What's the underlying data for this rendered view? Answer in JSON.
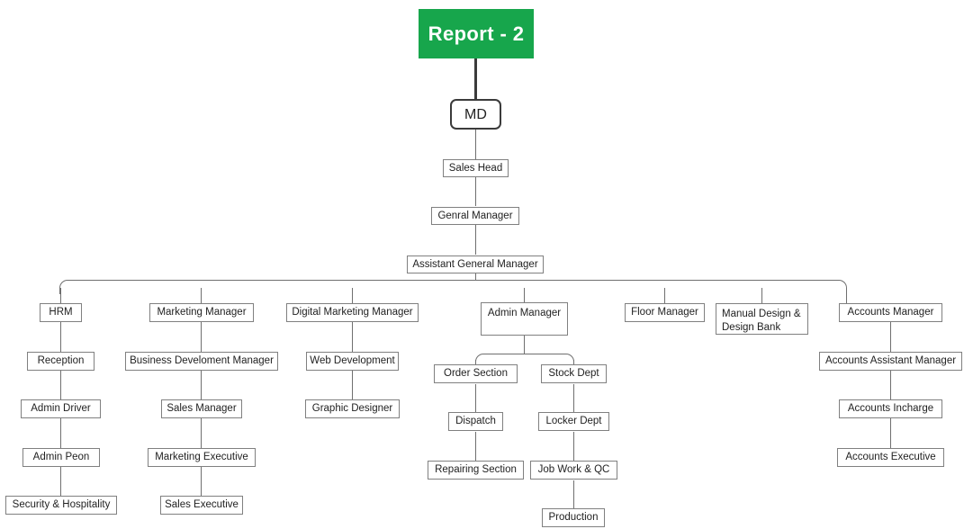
{
  "chart": {
    "title": "Report - 2",
    "type": "org-chart",
    "colors": {
      "root_fill": "#17a64c",
      "root_text": "#ffffff",
      "node_border": "#808080",
      "node_fill": "#ffffff",
      "node_text": "#222222",
      "connector": "#6f6f6f",
      "md_border": "#3b3b3b",
      "background": "#ffffff"
    }
  },
  "nodes": {
    "root": "Report - 2",
    "md": "MD",
    "sales_head": "Sales Head",
    "general_manager": "Genral Manager",
    "assistant_general_manager": "Assistant General Manager",
    "hrm": "HRM",
    "reception": "Reception",
    "admin_driver": "Admin Driver",
    "admin_peon": "Admin Peon",
    "security_hospitality": "Security & Hospitality",
    "marketing_manager": "Marketing Manager",
    "business_development_manager": "Business Develoment Manager",
    "sales_manager": "Sales Manager",
    "marketing_executive": "Marketing Executive",
    "sales_executive": "Sales Executive",
    "digital_marketing_manager": "Digital Marketing Manager",
    "web_development": "Web Development",
    "graphic_designer": "Graphic Designer",
    "admin_manager": "Admin Manager",
    "order_section": "Order Section",
    "dispatch": "Dispatch",
    "repairing_section": "Repairing Section",
    "stock_dept": "Stock Dept",
    "locker_dept": "Locker Dept",
    "job_work_qc": "Job Work & QC",
    "production": "Production",
    "floor_manager": "Floor Manager",
    "manual_design_bank_line1": "Manual Design &",
    "manual_design_bank_line2": "Design Bank",
    "accounts_manager": "Accounts Manager",
    "accounts_assistant_manager": "Accounts Assistant Manager",
    "accounts_incharge": "Accounts Incharge",
    "accounts_executive": "Accounts Executive"
  }
}
